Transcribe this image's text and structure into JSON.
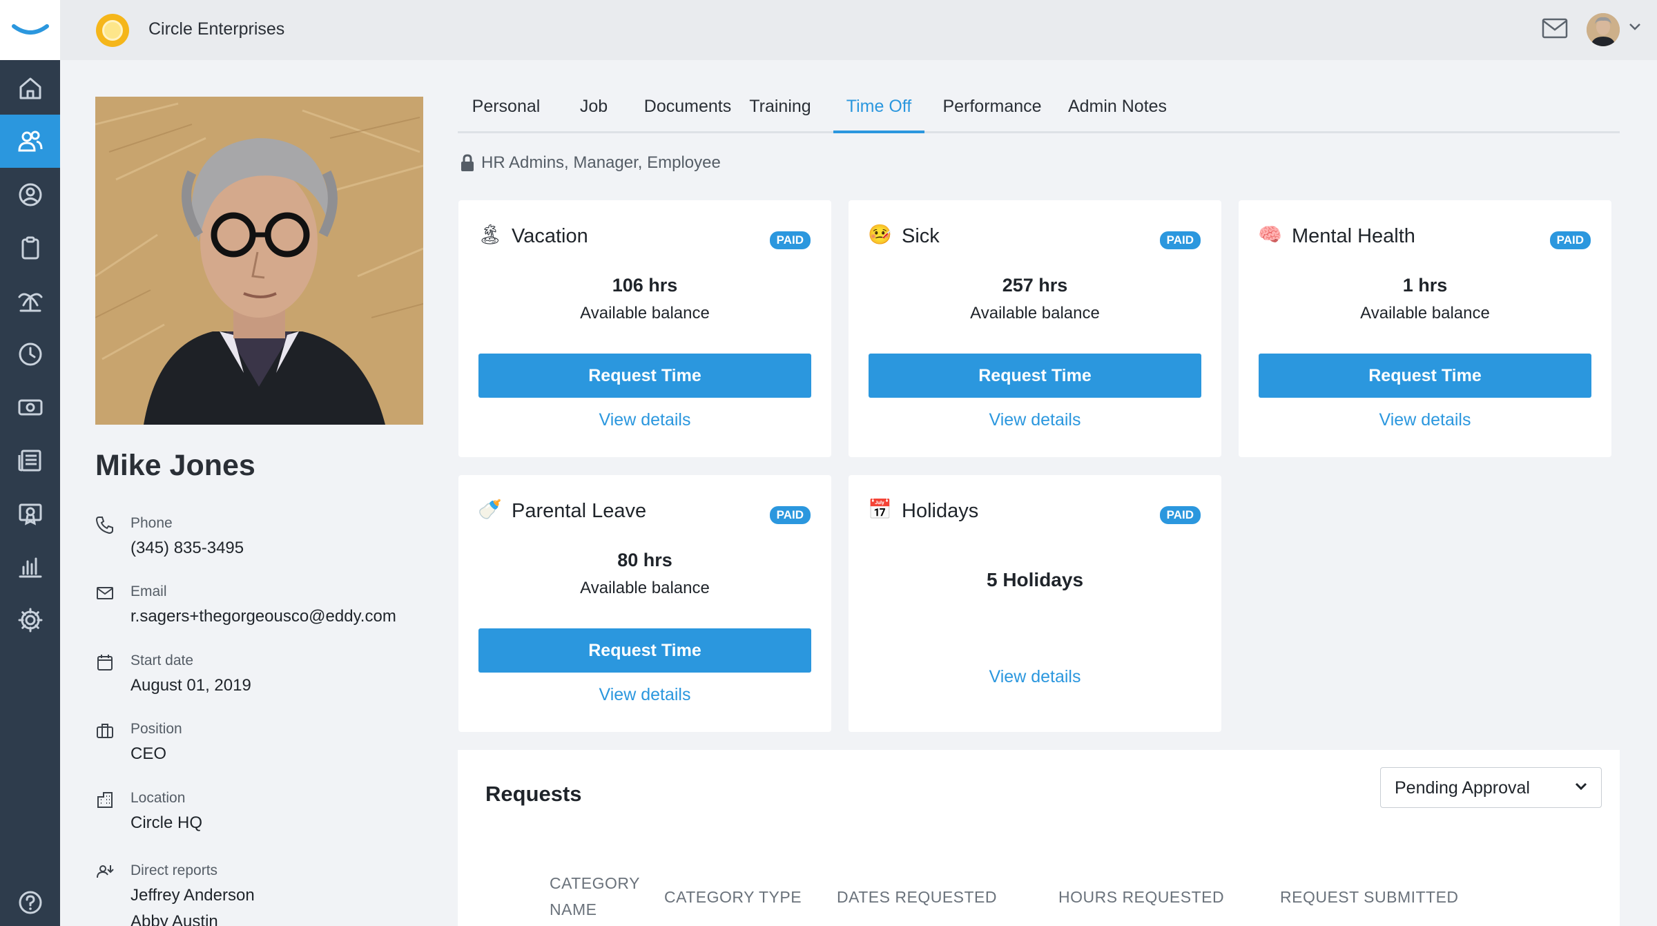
{
  "app": {
    "company_name": "Circle Enterprises"
  },
  "colors": {
    "accent": "#2b97de",
    "rail": "#2e3c4c",
    "topbar": "#e9ebee",
    "background": "#f1f3f6"
  },
  "sidebar": {
    "items": [
      {
        "name": "home-icon",
        "active": false
      },
      {
        "name": "people-icon",
        "active": true
      },
      {
        "name": "person-circle-icon",
        "active": false
      },
      {
        "name": "clipboard-icon",
        "active": false
      },
      {
        "name": "palm-tree-icon",
        "active": false
      },
      {
        "name": "clock-icon",
        "active": false
      },
      {
        "name": "money-icon",
        "active": false
      },
      {
        "name": "news-icon",
        "active": false
      },
      {
        "name": "certificate-icon",
        "active": false
      },
      {
        "name": "bar-chart-icon",
        "active": false
      },
      {
        "name": "gear-icon",
        "active": false
      }
    ],
    "help": "help-icon"
  },
  "profile": {
    "name": "Mike Jones",
    "phone": {
      "label": "Phone",
      "value": "(345) 835-3495"
    },
    "email": {
      "label": "Email",
      "value": "r.sagers+thegorgeousco@eddy.com"
    },
    "start_date": {
      "label": "Start date",
      "value": "August 01, 2019"
    },
    "position": {
      "label": "Position",
      "value": "CEO"
    },
    "location": {
      "label": "Location",
      "value": "Circle HQ"
    },
    "direct_reports": {
      "label": "Direct reports",
      "value": "Jeffrey Anderson",
      "next": "Abby Austin"
    }
  },
  "tabs": [
    {
      "label": "Personal",
      "active": false
    },
    {
      "label": "Job",
      "active": false
    },
    {
      "label": "Documents",
      "active": false
    },
    {
      "label": "Training",
      "active": false
    },
    {
      "label": "Time Off",
      "active": true
    },
    {
      "label": "Performance",
      "active": false
    },
    {
      "label": "Admin Notes",
      "active": false
    }
  ],
  "access_note": "HR Admins, Manager, Employee",
  "cards": [
    {
      "icon": "🏝",
      "title": "Vacation",
      "badge": "PAID",
      "hours": "106 hrs",
      "sub": "Available balance",
      "button": "Request Time",
      "link": "View details"
    },
    {
      "icon": "🤒",
      "title": "Sick",
      "badge": "PAID",
      "hours": "257 hrs",
      "sub": "Available balance",
      "button": "Request Time",
      "link": "View details"
    },
    {
      "icon": "🧠",
      "title": "Mental Health",
      "badge": "PAID",
      "hours": "1 hrs",
      "sub": "Available balance",
      "button": "Request Time",
      "link": "View details"
    },
    {
      "icon": "🍼",
      "title": "Parental Leave",
      "badge": "PAID",
      "hours": "80 hrs",
      "sub": "Available balance",
      "button": "Request Time",
      "link": "View details"
    },
    {
      "icon": "📅",
      "title": "Holidays",
      "badge": "PAID",
      "holidays": "5 Holidays",
      "link": "View details"
    }
  ],
  "requests": {
    "title": "Requests",
    "filter": "Pending Approval",
    "columns": [
      "CATEGORY NAME",
      "CATEGORY TYPE",
      "DATES REQUESTED",
      "HOURS REQUESTED",
      "REQUEST SUBMITTED"
    ]
  }
}
